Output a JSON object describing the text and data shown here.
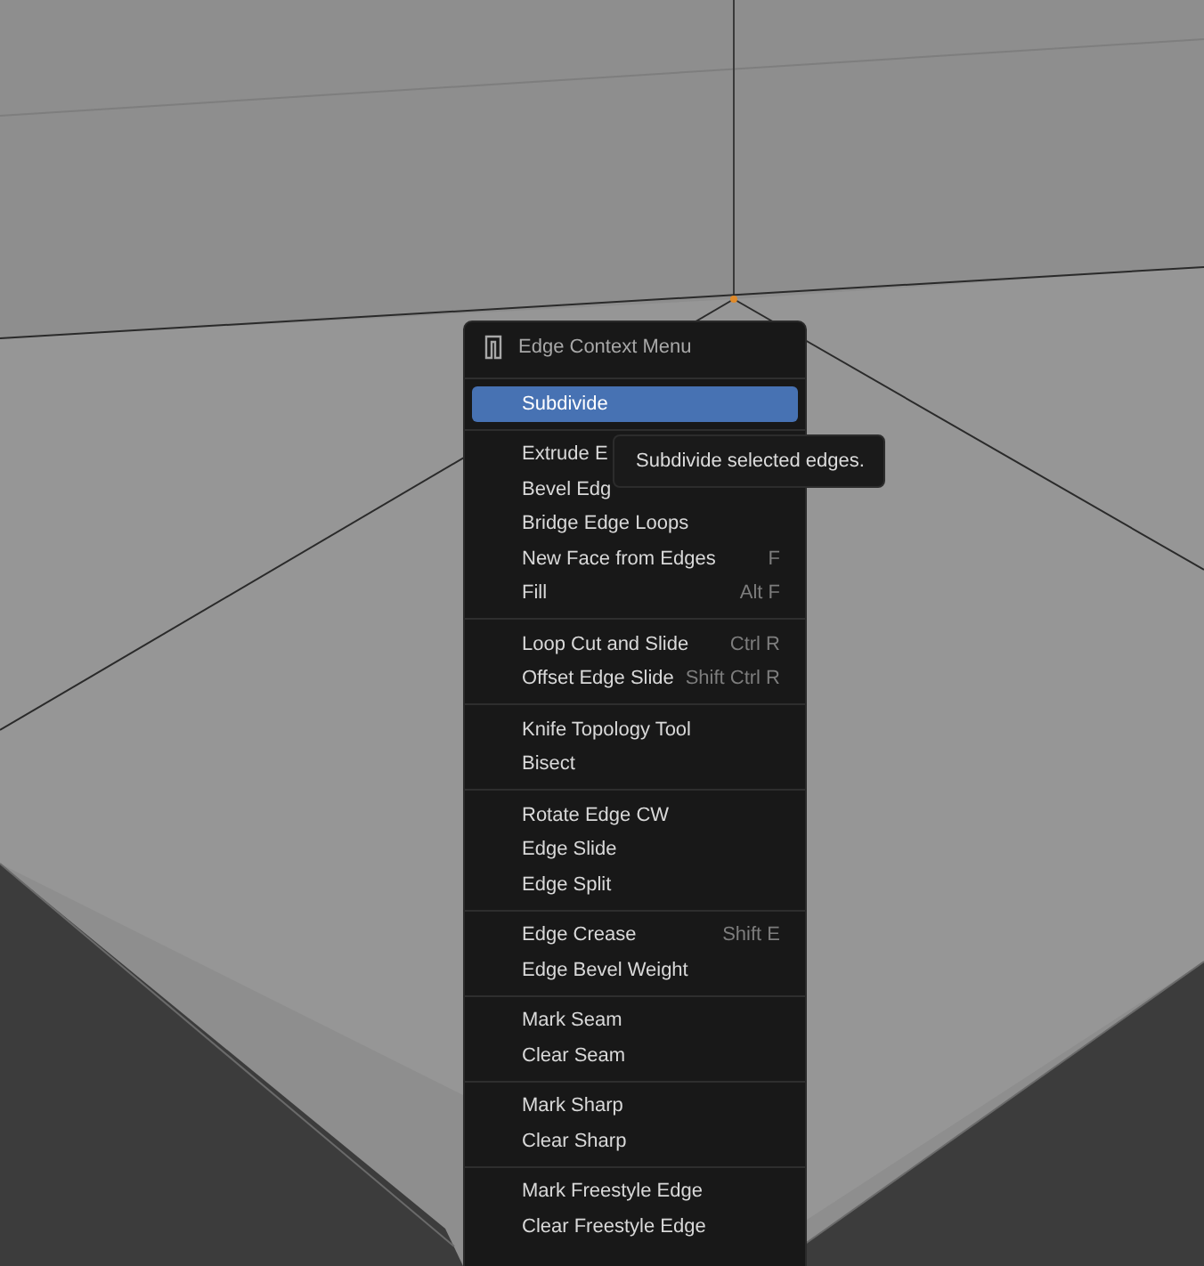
{
  "menu": {
    "title": "Edge Context Menu",
    "groups": [
      {
        "items": [
          {
            "label": "Subdivide",
            "selected": true
          }
        ]
      },
      {
        "items": [
          {
            "label": "Extrude E",
            "selected": false
          },
          {
            "label": "Bevel Edg",
            "selected": false
          },
          {
            "label": "Bridge Edge Loops",
            "selected": false
          },
          {
            "label": "New Face from Edges",
            "shortcut": "F",
            "selected": false
          },
          {
            "label": "Fill",
            "shortcut": "Alt F",
            "selected": false
          }
        ]
      },
      {
        "items": [
          {
            "label": "Loop Cut and Slide",
            "shortcut": "Ctrl R",
            "selected": false
          },
          {
            "label": "Offset Edge Slide",
            "shortcut": "Shift Ctrl R",
            "selected": false
          }
        ]
      },
      {
        "items": [
          {
            "label": "Knife Topology Tool",
            "selected": false
          },
          {
            "label": "Bisect",
            "selected": false
          }
        ]
      },
      {
        "items": [
          {
            "label": "Rotate Edge CW",
            "selected": false
          },
          {
            "label": "Edge Slide",
            "selected": false
          },
          {
            "label": "Edge Split",
            "selected": false
          }
        ]
      },
      {
        "items": [
          {
            "label": "Edge Crease",
            "shortcut": "Shift E",
            "selected": false
          },
          {
            "label": "Edge Bevel Weight",
            "selected": false
          }
        ]
      },
      {
        "items": [
          {
            "label": "Mark Seam",
            "selected": false
          },
          {
            "label": "Clear Seam",
            "selected": false
          }
        ]
      },
      {
        "items": [
          {
            "label": "Mark Sharp",
            "selected": false
          },
          {
            "label": "Clear Sharp",
            "selected": false
          }
        ]
      },
      {
        "items": [
          {
            "label": "Mark Freestyle Edge",
            "selected": false
          },
          {
            "label": "Clear Freestyle Edge",
            "selected": false
          }
        ]
      }
    ]
  },
  "tooltip": {
    "text": "Subdivide selected edges."
  }
}
